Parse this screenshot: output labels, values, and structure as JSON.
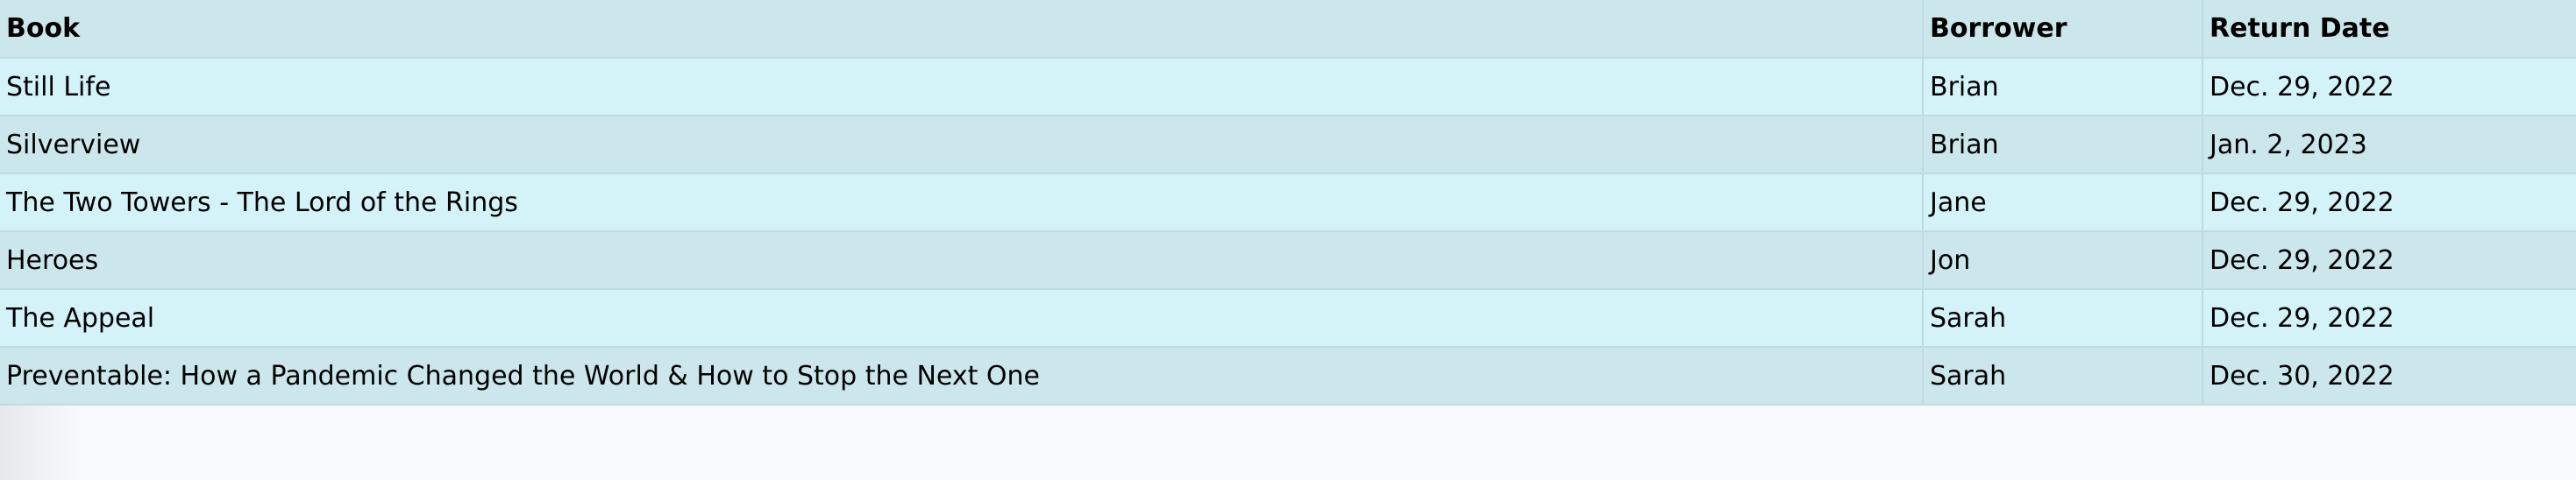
{
  "table": {
    "headers": {
      "book": "Book",
      "borrower": "Borrower",
      "return_date": "Return Date"
    },
    "rows": [
      {
        "book": "Still Life",
        "borrower": "Brian",
        "return_date": "Dec. 29, 2022"
      },
      {
        "book": "Silverview",
        "borrower": "Brian",
        "return_date": "Jan. 2, 2023"
      },
      {
        "book": "The Two Towers - The Lord of the Rings",
        "borrower": "Jane",
        "return_date": "Dec. 29, 2022"
      },
      {
        "book": "Heroes",
        "borrower": "Jon",
        "return_date": "Dec. 29, 2022"
      },
      {
        "book": "The Appeal",
        "borrower": "Sarah",
        "return_date": "Dec. 29, 2022"
      },
      {
        "book": "Preventable: How a Pandemic Changed the World & How to Stop the Next One",
        "borrower": "Sarah",
        "return_date": "Dec. 30, 2022"
      }
    ]
  },
  "colors": {
    "header_bg": "#cce7ec",
    "row_light": "#d3f3f8",
    "row_dark": "#cce7ec",
    "border": "#bfdbe2",
    "page_bg": "#f8f9fb"
  }
}
